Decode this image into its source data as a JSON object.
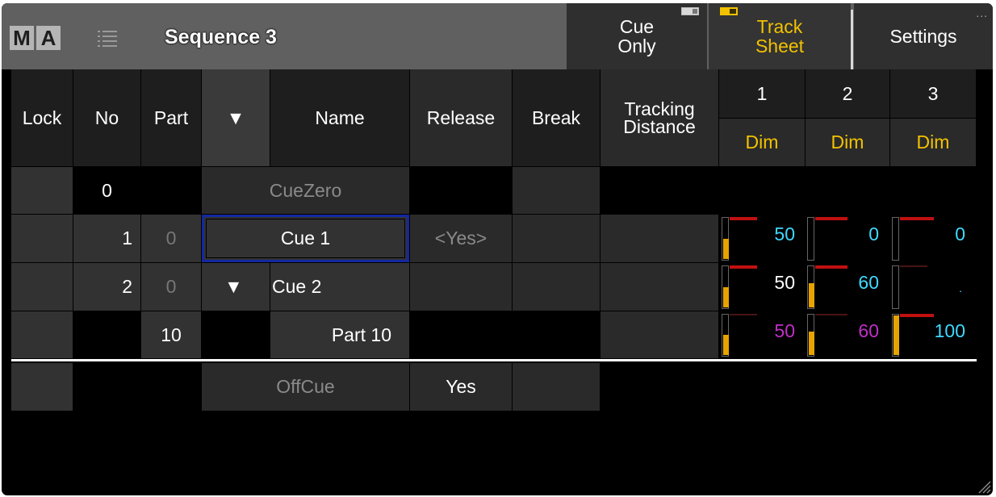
{
  "window": {
    "logo": [
      "M",
      "A"
    ],
    "title": "Sequence 3",
    "icons": {
      "list": "list-icon",
      "grip": "resize-grip-icon"
    }
  },
  "toolbar": {
    "cue_only": {
      "line1": "Cue",
      "line2": "Only"
    },
    "track_sheet": {
      "line1": "Track",
      "line2": "Sheet",
      "active": true
    },
    "settings": "Settings",
    "settings_dots": "..."
  },
  "columns": {
    "lock": "Lock",
    "no": "No",
    "part": "Part",
    "expand": "▼",
    "name": "Name",
    "release": "Release",
    "break": "Break",
    "tracking_line1": "Tracking",
    "tracking_line2": "Distance",
    "fixtures": [
      {
        "id": "1",
        "attr": "Dim"
      },
      {
        "id": "2",
        "attr": "Dim"
      },
      {
        "id": "3",
        "attr": "Dim"
      }
    ]
  },
  "rows": {
    "cuezero": {
      "no": "0",
      "name": "CueZero"
    },
    "cue1": {
      "no": "1",
      "part": "0",
      "name": "Cue  1",
      "release": "<Yes>",
      "values": [
        {
          "text": "50",
          "level": 0.5,
          "color": "#3fd9ff"
        },
        {
          "text": "0",
          "level": 0,
          "color": "#3fd9ff"
        },
        {
          "text": "0",
          "level": 0,
          "color": "#3fd9ff"
        }
      ]
    },
    "cue2": {
      "expand": "▼",
      "no": "2",
      "part": "0",
      "name": "Cue  2",
      "values": [
        {
          "text": "50",
          "level": 0.5,
          "color": "#ffffff"
        },
        {
          "text": "60",
          "level": 0.6,
          "color": "#3fd9ff"
        },
        {
          "text": ".",
          "level": 0,
          "color": "#3fd9ff"
        }
      ]
    },
    "part10": {
      "part": "10",
      "name": "Part  10",
      "values": [
        {
          "text": "50",
          "level": 0.5,
          "color": "#c02fc6"
        },
        {
          "text": "60",
          "level": 0.6,
          "color": "#c02fc6"
        },
        {
          "text": "100",
          "level": 1.0,
          "color": "#3fd9ff"
        }
      ]
    },
    "offcue": {
      "name": "OffCue",
      "release": "Yes"
    }
  },
  "colors": {
    "accent": "#f2c200",
    "fill": "#e6a300",
    "selection": "#1428a0"
  }
}
